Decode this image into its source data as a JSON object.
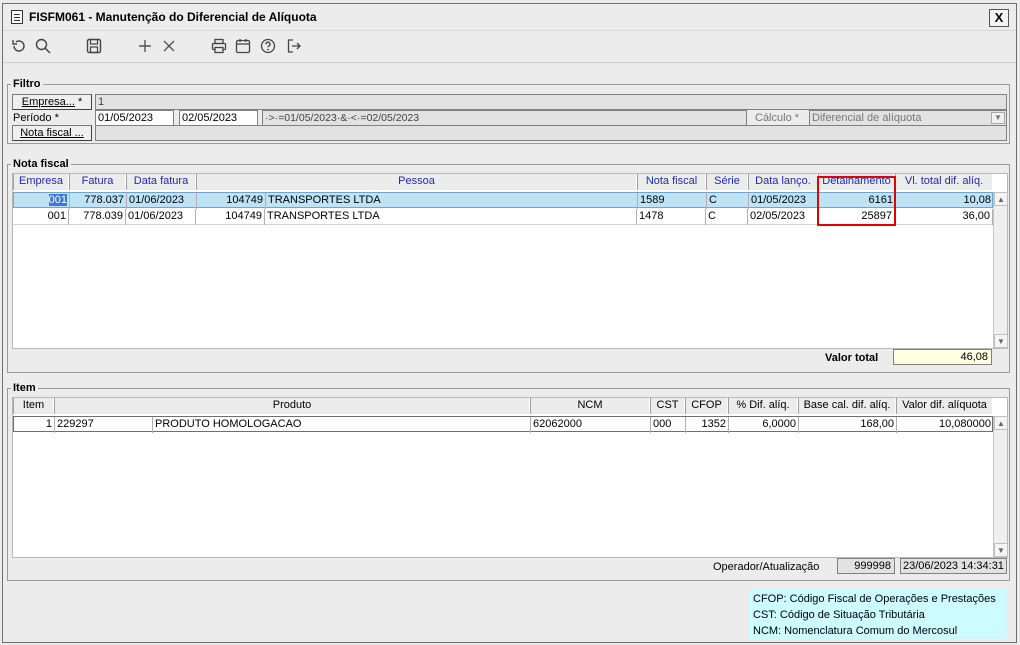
{
  "window": {
    "title": "FISFM061 - Manutenção do Diferencial de Alíquota",
    "close": "X"
  },
  "toolbar": {
    "undo": "⟲",
    "search": "⚲",
    "save": "🖫",
    "add": "+",
    "delete": "×",
    "print": "⎙",
    "calendar": "▦",
    "help": "?",
    "exit": "↦"
  },
  "filtro": {
    "label": "Filtro",
    "empresa_btn": "Empresa...",
    "empresa_req": "*",
    "empresa_value": "1",
    "periodo_label": "Período *",
    "periodo_ini": "01/05/2023",
    "periodo_fim": "02/05/2023",
    "periodo_expr": "·>·=01/05/2023·&·<·=02/05/2023",
    "calculo_label": "Cálculo *",
    "calculo_value": "Diferencial de alíquota",
    "nota_btn": "Nota fiscal ...",
    "nota_value": ""
  },
  "nota": {
    "label": "Nota fiscal",
    "headers": [
      "Empresa",
      "Fatura",
      "Data fatura",
      "Pessoa",
      "Nota fiscal",
      "Série",
      "Data lanço.",
      "Detalhamento",
      "Vl. total dif. alíq."
    ],
    "rows": [
      {
        "empresa": "001",
        "fatura": "778.037",
        "data_fatura": "01/06/2023",
        "pessoa_cod": "104749",
        "pessoa_nome": "TRANSPORTES LTDA",
        "nota": "1589",
        "serie": "C",
        "data_lanc": "01/05/2023",
        "detalhamento": "6161",
        "vl_total": "10,08"
      },
      {
        "empresa": "001",
        "fatura": "778.039",
        "data_fatura": "01/06/2023",
        "pessoa_cod": "104749",
        "pessoa_nome": "TRANSPORTES LTDA",
        "nota": "1478",
        "serie": "C",
        "data_lanc": "02/05/2023",
        "detalhamento": "25897",
        "vl_total": "36,00"
      }
    ],
    "total_label": "Valor total",
    "total_value": "46,08"
  },
  "item": {
    "label": "Item",
    "headers": [
      "Item",
      "Produto",
      "NCM",
      "CST",
      "CFOP",
      "% Dif. alíq.",
      "Base cal. dif. alíq.",
      "Valor dif. alíquota"
    ],
    "rows": [
      {
        "item": "1",
        "produto_cod": "229297",
        "produto_nome": "PRODUTO HOMOLOGACAO",
        "ncm": "62062000",
        "cst": "000",
        "cfop": "1352",
        "pct": "6,0000",
        "base": "168,00",
        "valor": "10,080000"
      }
    ],
    "operador_label": "Operador/Atualização",
    "operador_value": "999998",
    "atualizacao_value": "23/06/2023 14:34:31"
  },
  "legend": [
    "CFOP: Código Fiscal de Operações e Prestações",
    "CST: Código de Situação Tributária",
    "NCM: Nomenclatura Comum do Mercosul"
  ],
  "colors": {
    "highlight_box": "#e00000",
    "selected_row": "#bfe3f5",
    "total_bg": "#ffffe0",
    "legend_bg": "#ccfcff"
  }
}
